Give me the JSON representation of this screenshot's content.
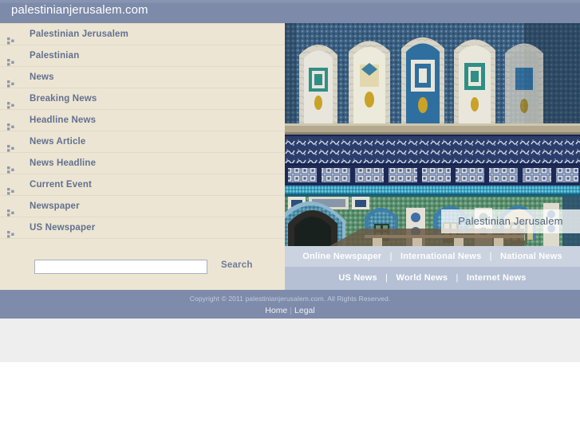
{
  "header": {
    "domain": "palestinianjerusalem.com",
    "bg_color": "#7d8aa9"
  },
  "sidebar": {
    "bg_color": "#ece5d3",
    "link_color": "#62718f",
    "items": [
      {
        "label": "Palestinian Jerusalem",
        "icon": "bullet-squares-icon"
      },
      {
        "label": "Palestinian",
        "icon": "bullet-squares-icon"
      },
      {
        "label": "News",
        "icon": "bullet-squares-icon"
      },
      {
        "label": "Breaking News",
        "icon": "bullet-squares-icon"
      },
      {
        "label": "Headline News",
        "icon": "bullet-squares-icon"
      },
      {
        "label": "News Article",
        "icon": "bullet-squares-icon"
      },
      {
        "label": "News Headline",
        "icon": "bullet-squares-icon"
      },
      {
        "label": "Current Event",
        "icon": "bullet-squares-icon"
      },
      {
        "label": "Newspaper",
        "icon": "bullet-squares-icon"
      },
      {
        "label": "US Newspaper",
        "icon": "bullet-squares-icon"
      }
    ]
  },
  "search": {
    "value": "",
    "placeholder": "",
    "button_label": "Search"
  },
  "hero": {
    "caption": "Palestinian Jerusalem",
    "alt": "Dome of the Rock tiled facade, Jerusalem"
  },
  "nav": {
    "separator": "|",
    "row1": [
      {
        "label": "Online Newspaper"
      },
      {
        "label": "International News"
      },
      {
        "label": "National News"
      }
    ],
    "row2": [
      {
        "label": "US News"
      },
      {
        "label": "World News"
      },
      {
        "label": "Internet News"
      }
    ]
  },
  "footer": {
    "copyright": "Copyright © 2011 palestinianjerusalem.com. All Rights Reserved.",
    "links": [
      {
        "label": "Home"
      },
      {
        "label": "Legal"
      }
    ],
    "separator": "|"
  }
}
